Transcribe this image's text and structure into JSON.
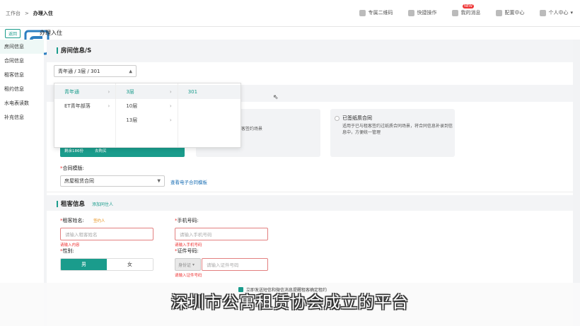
{
  "topbar": {
    "breadcrumb_root": "工作台",
    "breadcrumb_sep": ">",
    "breadcrumb_current": "办理入住",
    "actions": [
      {
        "label": "专属二维码",
        "icon": "qrcode-icon"
      },
      {
        "label": "快捷操作",
        "icon": "lightning-icon"
      },
      {
        "label": "我的消息",
        "icon": "bell-icon"
      },
      {
        "label": "配置中心",
        "icon": "gear-icon"
      },
      {
        "label": "个人中心",
        "icon": "user-icon"
      }
    ],
    "new_badge": "NEW"
  },
  "back_label": "返回",
  "page_title": "办理入住",
  "sidenav": [
    "房间信息",
    "合同信息",
    "租客信息",
    "租约信息",
    "水电表读数",
    "补充信息"
  ],
  "room_section": {
    "title": "房间信息/S",
    "selected_value": "青年通 / 3层 / 301"
  },
  "cascader": {
    "col1": [
      "青年通",
      "ET青年部落"
    ],
    "col2": [
      "3层",
      "10层",
      "13层"
    ],
    "col3": [
      "301"
    ]
  },
  "contract_cards": {
    "card2_desc": "客签约场景",
    "card3_title": "已签纸质合同",
    "card3_desc": "适用于已与租客签约过纸质合同场景，将合同信息补录到信息中，方便统一管理"
  },
  "green_bar": {
    "remaining": "剩余186份",
    "buy": "去购买"
  },
  "template": {
    "label": "合同模版:",
    "value": "房屋租赁合同",
    "link": "查看电子合同模板"
  },
  "tenant_section": {
    "title": "租客信息",
    "add_link": "添加同住人",
    "name_label": "租客姓名:",
    "sign_tag": "签约人",
    "name_placeholder": "请输入租客姓名",
    "name_error": "请输入内容",
    "phone_label": "手机号码:",
    "phone_placeholder": "请输入手机号码",
    "phone_error": "请输入手机号码",
    "gender_label": "性别:",
    "gender_male": "男",
    "gender_female": "女",
    "id_label": "证件号码:",
    "id_type": "身份证",
    "id_placeholder": "请输入证件号码",
    "id_error": "请输入证件号码"
  },
  "bottom": {
    "checkbox_label": "立即发送短信和微信消息提醒租客确定租约",
    "subtitle": "深圳市公寓租赁协会成立的平台"
  },
  "colors": {
    "accent": "#1a9c8c",
    "error": "#e33333",
    "link": "#1a6fb5"
  }
}
